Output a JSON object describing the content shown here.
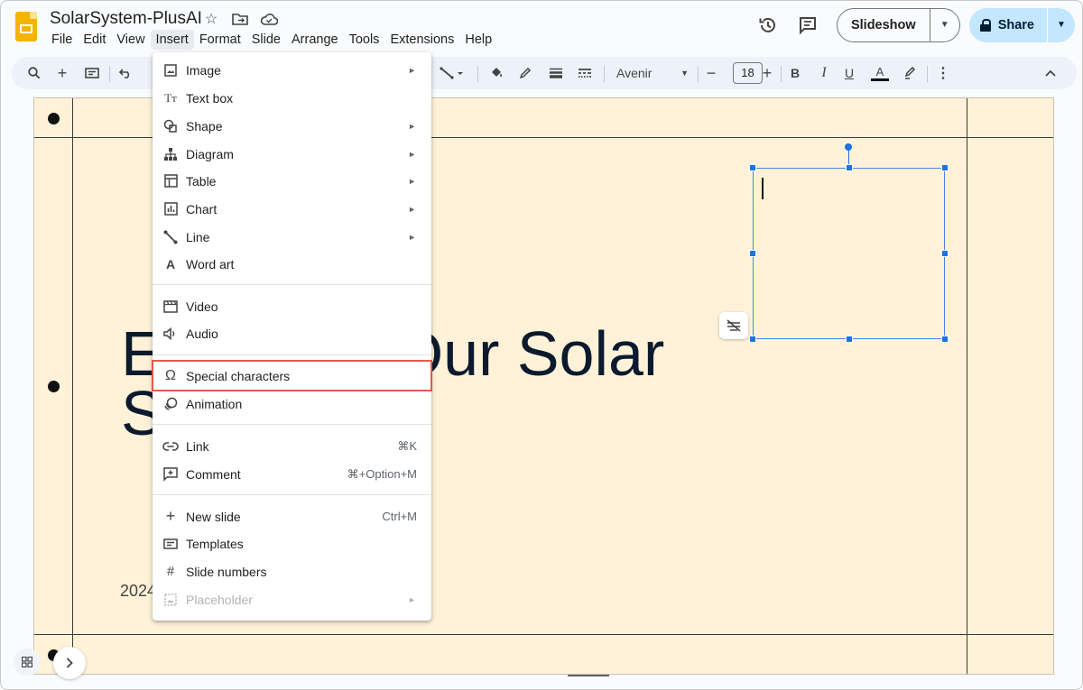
{
  "app": {
    "doc_title": "SolarSystem-PlusAI",
    "brand_color": "#f4b400"
  },
  "menubar": [
    "File",
    "Edit",
    "View",
    "Insert",
    "Format",
    "Slide",
    "Arrange",
    "Tools",
    "Extensions",
    "Help"
  ],
  "header": {
    "slideshow_label": "Slideshow",
    "share_label": "Share",
    "share_color": "#c2e7ff"
  },
  "toolbar": {
    "font": "Avenir",
    "font_size": "18",
    "minus": "−",
    "plus": "+"
  },
  "insert_menu": {
    "items": [
      {
        "label": "Image",
        "icon": "image-icon",
        "submenu": true
      },
      {
        "label": "Text box",
        "icon": "text-box-icon"
      },
      {
        "label": "Shape",
        "icon": "shape-icon",
        "submenu": true
      },
      {
        "label": "Diagram",
        "icon": "diagram-icon",
        "submenu": true
      },
      {
        "label": "Table",
        "icon": "table-icon",
        "submenu": true
      },
      {
        "label": "Chart",
        "icon": "chart-icon",
        "submenu": true
      },
      {
        "label": "Line",
        "icon": "line-icon",
        "submenu": true
      },
      {
        "label": "Word art",
        "icon": "word-art-icon"
      },
      {
        "label": "Video",
        "icon": "video-icon"
      },
      {
        "label": "Audio",
        "icon": "audio-icon"
      },
      {
        "label": "Special characters",
        "icon": "omega-icon",
        "highlighted": true
      },
      {
        "label": "Animation",
        "icon": "animation-icon"
      },
      {
        "label": "Link",
        "icon": "link-icon",
        "shortcut": "⌘K"
      },
      {
        "label": "Comment",
        "icon": "comment-icon",
        "shortcut": "⌘+Option+M"
      },
      {
        "label": "New slide",
        "icon": "plus-icon",
        "shortcut": "Ctrl+M"
      },
      {
        "label": "Templates",
        "icon": "templates-icon"
      },
      {
        "label": "Slide numbers",
        "icon": "hash-icon"
      },
      {
        "label": "Placeholder",
        "icon": "placeholder-icon",
        "submenu": true,
        "disabled": true
      }
    ]
  },
  "slide": {
    "title_line1": "E",
    "title_line1_rest": "Our Solar",
    "title_line2": "S",
    "subtitle": "2024",
    "background": "#fff2d8"
  },
  "highlight_color": "#e25a4a"
}
